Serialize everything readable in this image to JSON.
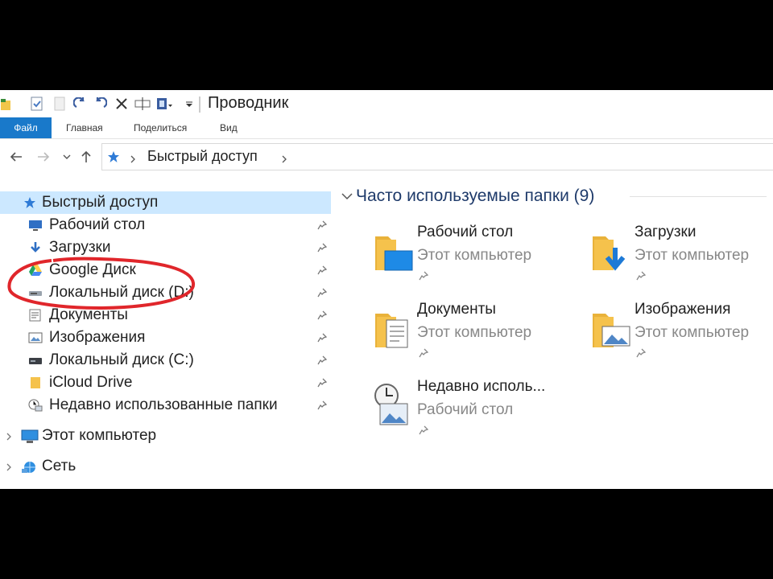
{
  "window": {
    "title": "Проводник"
  },
  "ribbon": {
    "tabs": [
      "Файл",
      "Главная",
      "Поделиться",
      "Вид"
    ]
  },
  "address": {
    "path": "Быстрый доступ"
  },
  "sidebar": {
    "quick_access": "Быстрый доступ",
    "pinned": [
      {
        "label": "Рабочий стол",
        "icon": "desktop-icon"
      },
      {
        "label": "Загрузки",
        "icon": "download-icon"
      },
      {
        "label": "Google Диск",
        "icon": "google-drive-icon"
      },
      {
        "label": "Локальный диск (D:)",
        "icon": "drive-icon"
      },
      {
        "label": "Документы",
        "icon": "documents-icon"
      },
      {
        "label": "Изображения",
        "icon": "pictures-icon"
      },
      {
        "label": "Локальный диск (C:)",
        "icon": "drive-icon"
      },
      {
        "label": "iCloud Drive",
        "icon": "folder-icon"
      },
      {
        "label": "Недавно использованные папки",
        "icon": "recent-icon"
      }
    ],
    "this_pc": "Этот компьютер",
    "network": "Сеть"
  },
  "main": {
    "group_title": "Часто используемые папки (9)",
    "tiles": [
      {
        "name": "Рабочий стол",
        "location": "Этот компьютер",
        "icon": "desktop-folder-icon"
      },
      {
        "name": "Загрузки",
        "location": "Этот компьютер",
        "icon": "downloads-folder-icon"
      },
      {
        "name": "Документы",
        "location": "Этот компьютер",
        "icon": "documents-folder-icon"
      },
      {
        "name": "Изображения",
        "location": "Этот компьютер",
        "icon": "pictures-folder-icon"
      },
      {
        "name": "Недавно исполь...",
        "location": "Рабочий стол",
        "icon": "recent-folder-icon"
      }
    ]
  },
  "colors": {
    "accent": "#1979ca",
    "selection": "#cce8ff",
    "annotation": "#e0262b",
    "folder": "#f5c24c"
  }
}
